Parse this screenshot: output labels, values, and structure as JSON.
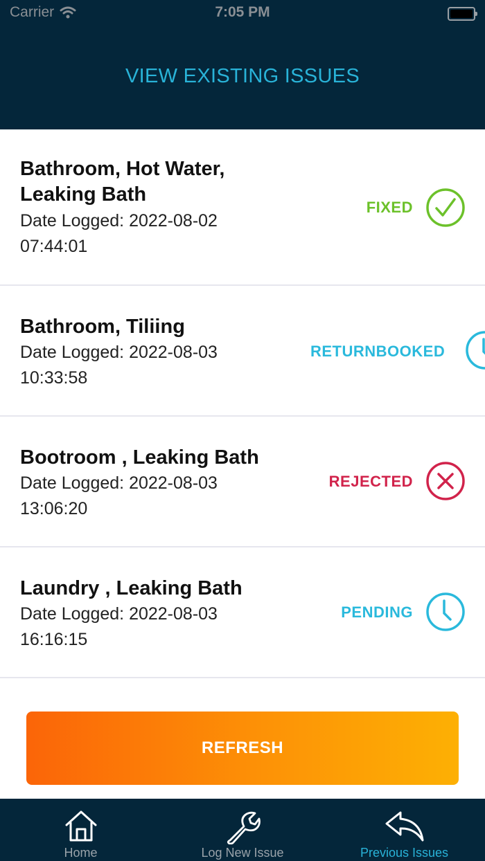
{
  "status_bar": {
    "carrier": "Carrier",
    "time": "7:05 PM"
  },
  "header": {
    "title": "VIEW EXISTING ISSUES"
  },
  "issues": [
    {
      "title": "Bathroom, Hot Water, Leaking Bath",
      "date": "Date Logged: 2022-08-02 07:44:01",
      "status": "FIXED",
      "status_color": "#6cc12a",
      "icon": "check-circle-icon"
    },
    {
      "title": "Bathroom, Tiliing",
      "date": "Date Logged: 2022-08-03 10:33:58",
      "status": "RETURNBOOKED",
      "status_color": "#2ab9dc",
      "icon": "clock-icon"
    },
    {
      "title": "Bootroom , Leaking Bath",
      "date": "Date Logged: 2022-08-03 13:06:20",
      "status": "REJECTED",
      "status_color": "#d1234b",
      "icon": "x-circle-icon"
    },
    {
      "title": "Laundry  , Leaking Bath",
      "date": "Date Logged: 2022-08-03 16:16:15",
      "status": "PENDING",
      "status_color": "#2ab9dc",
      "icon": "clock-icon"
    }
  ],
  "refresh_label": "REFRESH",
  "tabs": [
    {
      "label": "Home",
      "icon": "home-icon",
      "active": false
    },
    {
      "label": "Log New Issue",
      "icon": "wrench-icon",
      "active": false
    },
    {
      "label": "Previous Issues",
      "icon": "reply-arrow-icon",
      "active": true
    }
  ],
  "colors": {
    "header_bg": "#04263a",
    "accent": "#29b3d8",
    "tab_inactive": "#9aa3aa"
  }
}
